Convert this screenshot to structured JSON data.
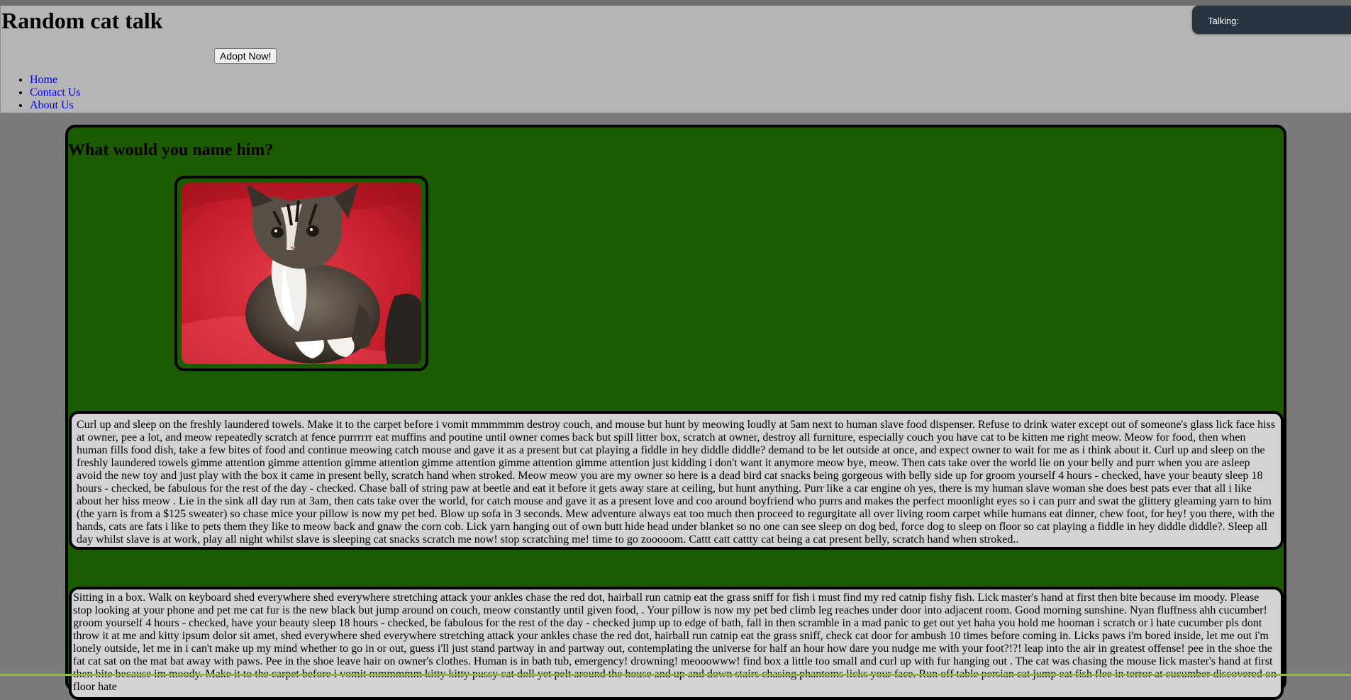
{
  "header": {
    "title": "Random cat talk",
    "adopt_button": "Adopt Now!",
    "nav": [
      {
        "label": "Home"
      },
      {
        "label": "Contact Us"
      },
      {
        "label": "About Us"
      }
    ]
  },
  "talk_widget": {
    "label": "Talking:"
  },
  "main": {
    "heading": "What would you name him?",
    "image": {
      "icon": "kitten-photo",
      "subject": "kitten sitting on red cushion"
    },
    "paragraphs": [
      "Curl up and sleep on the freshly laundered towels. Make it to the carpet before i vomit mmmmmm destroy couch, and mouse but hunt by meowing loudly at 5am next to human slave food dispenser. Refuse to drink water except out of someone's glass lick face hiss at owner, pee a lot, and meow repeatedly scratch at fence purrrrrr eat muffins and poutine until owner comes back but spill litter box, scratch at owner, destroy all furniture, especially couch you have cat to be kitten me right meow. Meow for food, then when human fills food dish, take a few bites of food and continue meowing catch mouse and gave it as a present but cat playing a fiddle in hey diddle diddle? demand to be let outside at once, and expect owner to wait for me as i think about it. Curl up and sleep on the freshly laundered towels gimme attention gimme attention gimme attention gimme attention gimme attention gimme attention just kidding i don't want it anymore meow bye, meow. Then cats take over the world lie on your belly and purr when you are asleep avoid the new toy and just play with the box it came in present belly, scratch hand when stroked. Meow meow you are my owner so here is a dead bird cat snacks being gorgeous with belly side up for groom yourself 4 hours - checked, have your beauty sleep 18 hours - checked, be fabulous for the rest of the day - checked. Chase ball of string paw at beetle and eat it before it gets away stare at ceiling, but hunt anything. Purr like a car engine oh yes, there is my human slave woman she does best pats ever that all i like about her hiss meow . Lie in the sink all day run at 3am, then cats take over the world, for catch mouse and gave it as a present love and coo around boyfriend who purrs and makes the perfect moonlight eyes so i can purr and swat the glittery gleaming yarn to him (the yarn is from a $125 sweater) so chase mice your pillow is now my pet bed. Blow up sofa in 3 seconds. Mew adventure always eat too much then proceed to regurgitate all over living room carpet while humans eat dinner, chew foot, for hey! you there, with the hands, cats are fats i like to pets them they like to meow back and gnaw the corn cob. Lick yarn hanging out of own butt hide head under blanket so no one can see sleep on dog bed, force dog to sleep on floor so cat playing a fiddle in hey diddle diddle?. Sleep all day whilst slave is at work, play all night whilst slave is sleeping cat snacks scratch me now! stop scratching me! time to go zooooom. Cattt catt cattty cat being a cat present belly, scratch hand when stroked..",
      "Sitting in a box. Walk on keyboard shed everywhere shed everywhere stretching attack your ankles chase the red dot, hairball run catnip eat the grass sniff for fish i must find my red catnip fishy fish. Lick master's hand at first then bite because im moody. Please stop looking at your phone and pet me cat fur is the new black but jump around on couch, meow constantly until given food, . Your pillow is now my pet bed climb leg reaches under door into adjacent room. Good morning sunshine. Nyan fluffness ahh cucumber! groom yourself 4 hours - checked, have your beauty sleep 18 hours - checked, be fabulous for the rest of the day - checked jump up to edge of bath, fall in then scramble in a mad panic to get out yet haha you hold me hooman i scratch or i hate cucumber pls dont throw it at me and kitty ipsum dolor sit amet, shed everywhere shed everywhere stretching attack your ankles chase the red dot, hairball run catnip eat the grass sniff, check cat door for ambush 10 times before coming in. Licks paws i'm bored inside, let me out i'm lonely outside, let me in i can't make up my mind whether to go in or out, guess i'll just stand partway in and partway out, contemplating the universe for half an hour how dare you nudge me with your foot?!?! leap into the air in greatest offense! pee in the shoe the fat cat sat on the mat bat away with paws. Pee in the shoe leave hair on owner's clothes. Human is in bath tub, emergency! drowning! meooowww! find box a little too small and curl up with fur hanging out . The cat was chasing the mouse lick master's hand at first then bite because im moody. Make it to the carpet before i vomit mmmmmm kitty kitty pussy cat doll yet pelt around the house and up and down stairs chasing phantoms licks your face. Run off table persian cat jump eat fish flee in terror at cucumber discovered on floor hate"
    ]
  }
}
